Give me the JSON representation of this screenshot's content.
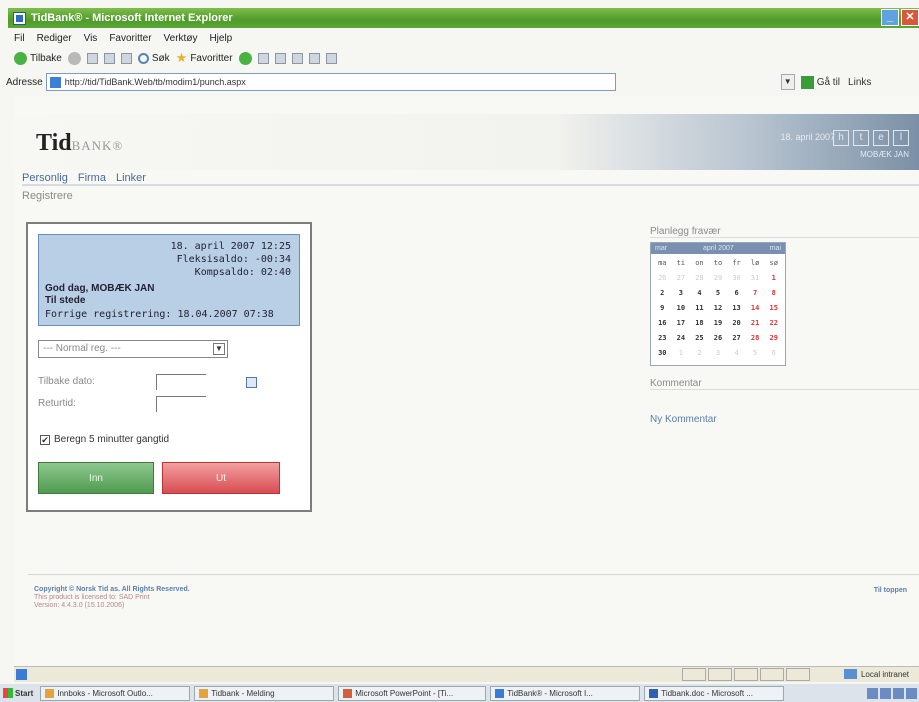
{
  "window": {
    "title": "TidBank® - Microsoft Internet Explorer",
    "buttons": {
      "minimize": "_",
      "maximize": "▫",
      "close": "✕"
    }
  },
  "menu": [
    "Fil",
    "Rediger",
    "Vis",
    "Favoritter",
    "Verktøy",
    "Hjelp"
  ],
  "toolbar": {
    "back": "Tilbake",
    "search": "Søk",
    "favorites": "Favoritter"
  },
  "address": {
    "label": "Adresse",
    "url": "http://tid/TidBank.Web/tb/modim1/punch.aspx",
    "go": "Gå til",
    "links": "Links"
  },
  "header": {
    "logo_main": "Tid",
    "logo_sub": "BANK®",
    "date": "18. april 2007",
    "buttons": [
      "h",
      "t",
      "e",
      "l"
    ],
    "user": "MOBÆK JAN"
  },
  "nav": [
    "Personlig",
    "Firma",
    "Linker"
  ],
  "breadcrumb": "Registrere",
  "punch": {
    "datetime": "18. april 2007 12:25",
    "flex": "Fleksisaldo: -00:34",
    "komp": "Kompsaldo: 02:40",
    "greeting": "God dag, MOBÆK JAN",
    "status": "Til stede",
    "last": "Forrige registrering: 18.04.2007 07:38",
    "select_value": "--- Normal reg. ---",
    "back_date_label": "Tilbake dato:",
    "return_label": "Returtid:",
    "walk_label": "Beregn 5 minutter gangtid",
    "walk_checked": "✔",
    "in_label": "Inn",
    "out_label": "Ut"
  },
  "absence": {
    "title": "Planlegg fravær",
    "calendar": {
      "prev": "mar",
      "month": "april 2007",
      "next": "mai",
      "dow": [
        "ma",
        "ti",
        "on",
        "to",
        "fr",
        "lø",
        "sø"
      ],
      "days": [
        {
          "d": "26",
          "c": "other"
        },
        {
          "d": "27",
          "c": "other"
        },
        {
          "d": "28",
          "c": "other"
        },
        {
          "d": "29",
          "c": "other"
        },
        {
          "d": "30",
          "c": "other"
        },
        {
          "d": "31",
          "c": "other"
        },
        {
          "d": "1",
          "c": "we"
        },
        {
          "d": "2",
          "c": ""
        },
        {
          "d": "3",
          "c": ""
        },
        {
          "d": "4",
          "c": ""
        },
        {
          "d": "5",
          "c": ""
        },
        {
          "d": "6",
          "c": ""
        },
        {
          "d": "7",
          "c": "we"
        },
        {
          "d": "8",
          "c": "we"
        },
        {
          "d": "9",
          "c": ""
        },
        {
          "d": "10",
          "c": ""
        },
        {
          "d": "11",
          "c": ""
        },
        {
          "d": "12",
          "c": ""
        },
        {
          "d": "13",
          "c": ""
        },
        {
          "d": "14",
          "c": "we"
        },
        {
          "d": "15",
          "c": "we"
        },
        {
          "d": "16",
          "c": ""
        },
        {
          "d": "17",
          "c": ""
        },
        {
          "d": "18",
          "c": ""
        },
        {
          "d": "19",
          "c": ""
        },
        {
          "d": "20",
          "c": ""
        },
        {
          "d": "21",
          "c": "we"
        },
        {
          "d": "22",
          "c": "we"
        },
        {
          "d": "23",
          "c": ""
        },
        {
          "d": "24",
          "c": ""
        },
        {
          "d": "25",
          "c": ""
        },
        {
          "d": "26",
          "c": ""
        },
        {
          "d": "27",
          "c": ""
        },
        {
          "d": "28",
          "c": "we"
        },
        {
          "d": "29",
          "c": "we"
        },
        {
          "d": "30",
          "c": ""
        },
        {
          "d": "1",
          "c": "other"
        },
        {
          "d": "2",
          "c": "other"
        },
        {
          "d": "3",
          "c": "other"
        },
        {
          "d": "4",
          "c": "other"
        },
        {
          "d": "5",
          "c": "other"
        },
        {
          "d": "6",
          "c": "other"
        }
      ]
    }
  },
  "comments": {
    "title": "Kommentar",
    "new": "Ny Kommentar"
  },
  "footer": {
    "copyright": "Copyright © Norsk Tid as. All Rights Reserved.",
    "license": "This product is licensed to: SAD Print",
    "version": "Version: 4.4.3.0 (15.10.2006)",
    "top": "Til toppen"
  },
  "status": {
    "zone": "Local intranet"
  },
  "taskbar": {
    "start": "Start",
    "tasks": [
      "Innboks - Microsoft Outlo...",
      "Tidbank - Melding",
      "Microsoft PowerPoint - [Ti...",
      "TidBank® - Microsoft I...",
      "Tidbank.doc - Microsoft ..."
    ]
  },
  "colors": {
    "titlebar": "#5aa833",
    "info_box": "#b9cfe6",
    "inn_button": "#4f9a4f",
    "ut_button": "#d74c52",
    "link": "#5b7fa8"
  }
}
